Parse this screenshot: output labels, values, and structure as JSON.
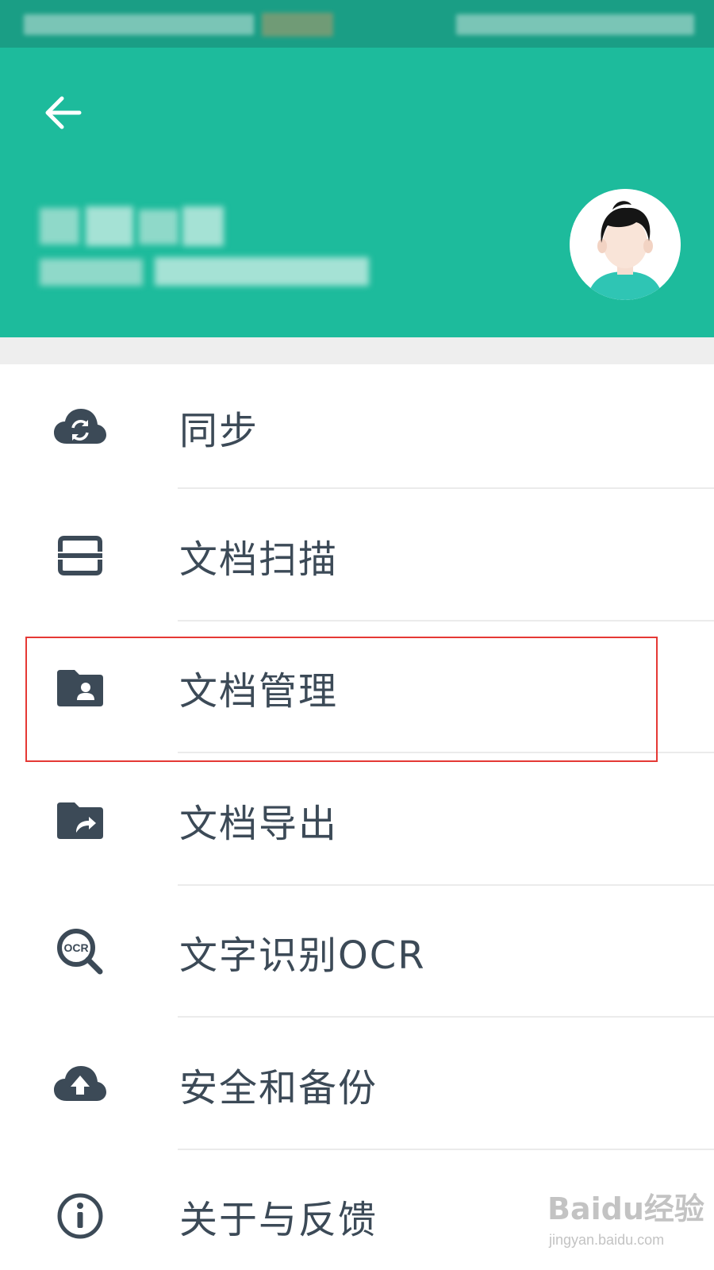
{
  "theme": {
    "header_color": "#1dbb9c",
    "statusbar_color": "#1a9e85",
    "icon_color": "#3c4a57",
    "text_color": "#3c4a57",
    "highlight_color": "#e53935"
  },
  "header": {
    "back_icon": "arrow-left-icon",
    "avatar_icon": "user-avatar-icon"
  },
  "menu": {
    "items": [
      {
        "label": "同步",
        "icon": "cloud-sync-icon"
      },
      {
        "label": "文档扫描",
        "icon": "scan-frame-icon"
      },
      {
        "label": "文档管理",
        "icon": "folder-user-icon",
        "highlighted": true
      },
      {
        "label": "文档导出",
        "icon": "folder-share-icon"
      },
      {
        "label": "文字识别OCR",
        "icon": "ocr-search-icon"
      },
      {
        "label": "安全和备份",
        "icon": "cloud-upload-icon"
      },
      {
        "label": "关于与反馈",
        "icon": "info-icon"
      }
    ]
  },
  "watermark": {
    "main": "Baidu经验",
    "sub": "jingyan.baidu.com"
  }
}
